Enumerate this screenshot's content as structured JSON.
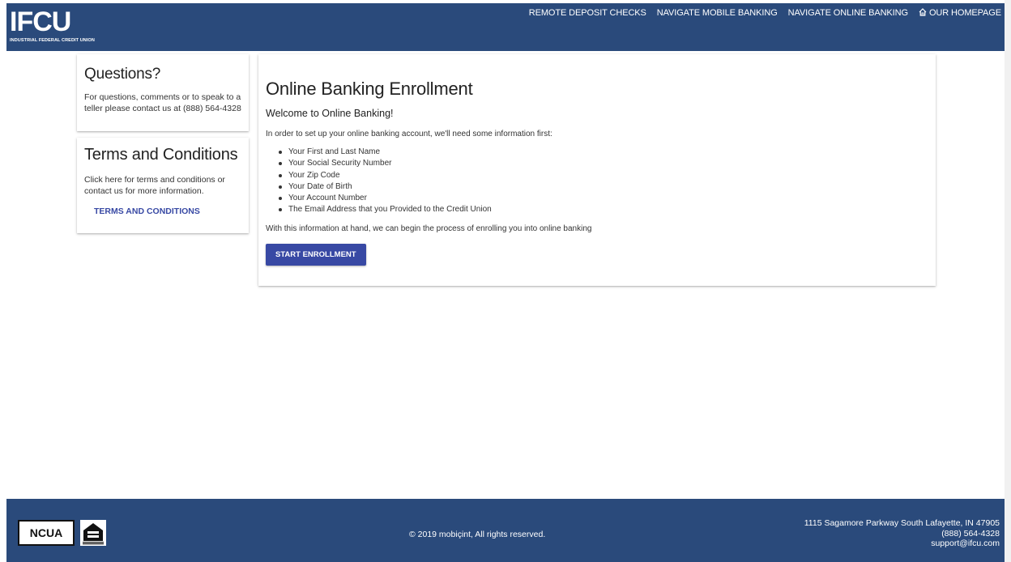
{
  "header": {
    "logo_text": "IFCU",
    "logo_subtitle": "INDUSTRIAL FEDERAL CREDIT UNION",
    "nav": [
      {
        "label": "REMOTE DEPOSIT CHECKS",
        "icon": null
      },
      {
        "label": "NAVIGATE MOBILE BANKING",
        "icon": null
      },
      {
        "label": "NAVIGATE ONLINE BANKING",
        "icon": null
      },
      {
        "label": "OUR HOMEPAGE",
        "icon": "home-icon"
      }
    ]
  },
  "sidebar": {
    "questions": {
      "title": "Questions?",
      "text": "For questions, comments or to speak to a teller please contact us at (888) 564-4328"
    },
    "terms": {
      "title": "Terms and Conditions",
      "text": "Click here for terms and conditions or contact us for more information.",
      "link": "TERMS AND CONDITIONS"
    }
  },
  "main": {
    "title": "Online Banking Enrollment",
    "subtitle": "Welcome to Online Banking!",
    "intro": "In order to set up your online banking account, we'll need some information first:",
    "requirements": [
      "Your First and Last Name",
      "Your Social Security Number",
      "Your Zip Code",
      "Your Date of Birth",
      "Your Account Number",
      "The Email Address that you Provided to the Credit Union"
    ],
    "outro": "With this information at hand, we can begin the process of enrolling you into online banking",
    "button_label": "START ENROLLMENT"
  },
  "footer": {
    "ncua_label": "NCUA",
    "copyright": "© 2019 mobiçint, All rights reserved.",
    "address": "1115 Sagamore Parkway South Lafayette, IN 47905",
    "phone": "(888) 564-4328",
    "email": "support@ifcu.com"
  },
  "colors": {
    "header_bg": "#2a4a7b",
    "accent": "#3849a4"
  }
}
